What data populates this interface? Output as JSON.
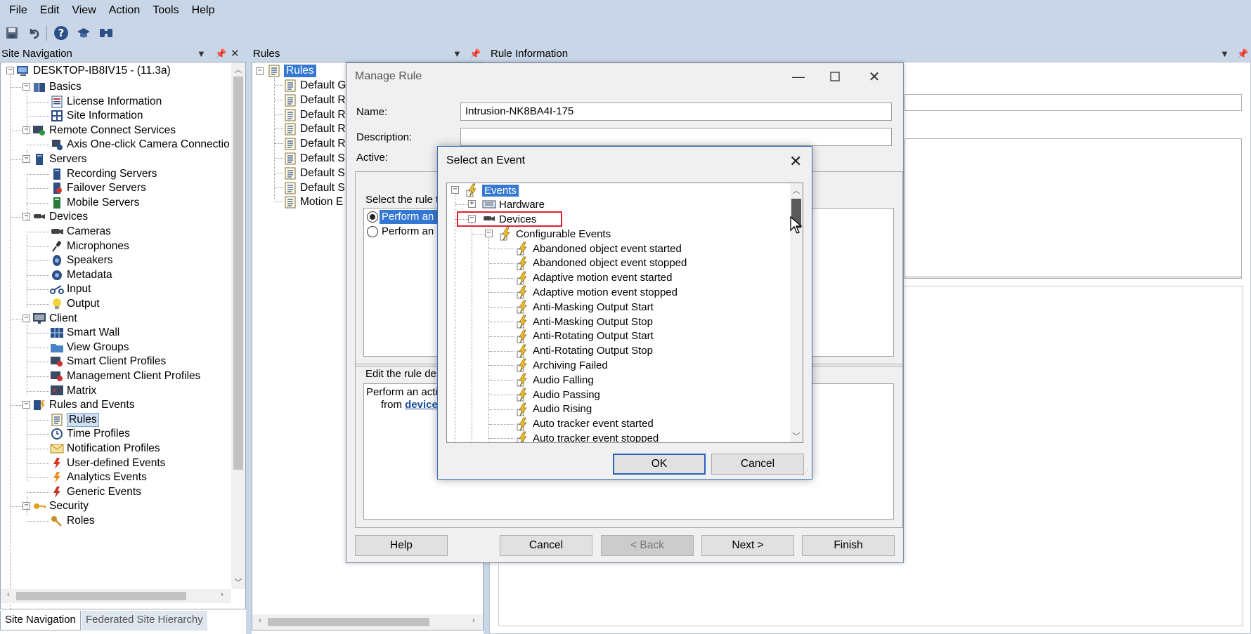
{
  "menu": [
    "File",
    "Edit",
    "View",
    "Action",
    "Tools",
    "Help"
  ],
  "panes": {
    "site_nav_title": "Site Navigation",
    "rules_title": "Rules",
    "rule_info_title": "Rule Information"
  },
  "site_tree": {
    "root": "DESKTOP-IB8IV15 - (11.3a)",
    "items": [
      {
        "label": "Basics",
        "level": 1,
        "expander": "minus"
      },
      {
        "label": "License Information",
        "level": 2
      },
      {
        "label": "Site Information",
        "level": 2
      },
      {
        "label": "Remote Connect Services",
        "level": 1,
        "expander": "minus"
      },
      {
        "label": "Axis One-click Camera Connectio",
        "level": 2
      },
      {
        "label": "Servers",
        "level": 1,
        "expander": "minus"
      },
      {
        "label": "Recording Servers",
        "level": 2
      },
      {
        "label": "Failover Servers",
        "level": 2
      },
      {
        "label": "Mobile Servers",
        "level": 2
      },
      {
        "label": "Devices",
        "level": 1,
        "expander": "minus"
      },
      {
        "label": "Cameras",
        "level": 2
      },
      {
        "label": "Microphones",
        "level": 2
      },
      {
        "label": "Speakers",
        "level": 2
      },
      {
        "label": "Metadata",
        "level": 2
      },
      {
        "label": "Input",
        "level": 2
      },
      {
        "label": "Output",
        "level": 2
      },
      {
        "label": "Client",
        "level": 1,
        "expander": "minus"
      },
      {
        "label": "Smart Wall",
        "level": 2
      },
      {
        "label": "View Groups",
        "level": 2
      },
      {
        "label": "Smart Client Profiles",
        "level": 2
      },
      {
        "label": "Management Client Profiles",
        "level": 2
      },
      {
        "label": "Matrix",
        "level": 2
      },
      {
        "label": "Rules and Events",
        "level": 1,
        "expander": "minus"
      },
      {
        "label": "Rules",
        "level": 2,
        "selected": true
      },
      {
        "label": "Time Profiles",
        "level": 2
      },
      {
        "label": "Notification Profiles",
        "level": 2
      },
      {
        "label": "User-defined Events",
        "level": 2
      },
      {
        "label": "Analytics Events",
        "level": 2
      },
      {
        "label": "Generic Events",
        "level": 2
      },
      {
        "label": "Security",
        "level": 1,
        "expander": "minus"
      },
      {
        "label": "Roles",
        "level": 2
      }
    ]
  },
  "bottom_tabs": [
    "Site Navigation",
    "Federated Site Hierarchy"
  ],
  "rules_tree": {
    "root": "Rules",
    "items": [
      "Default G",
      "Default R",
      "Default R",
      "Default R",
      "Default R",
      "Default S",
      "Default S",
      "Default S",
      "Motion E"
    ]
  },
  "manage_rule": {
    "title": "Manage Rule",
    "name_label": "Name:",
    "name_value": "Intrusion-NK8BA4I-175",
    "description_label": "Description:",
    "active_label": "Active:",
    "select_type_label": "Select the rule ty",
    "radio1": "Perform an a",
    "radio2": "Perform an a",
    "edit_desc_label": "Edit the rule des",
    "desc_line1": "Perform an actio",
    "desc_line2_prefix": "from ",
    "desc_line2_link": "device",
    "buttons": {
      "help": "Help",
      "cancel": "Cancel",
      "back": "< Back",
      "next": "Next >",
      "finish": "Finish"
    }
  },
  "select_event": {
    "title": "Select an Event",
    "root": "Events",
    "hardware": "Hardware",
    "devices": "Devices",
    "configurable": "Configurable Events",
    "events": [
      "Abandoned object event started",
      "Abandoned object event stopped",
      "Adaptive motion event started",
      "Adaptive motion event stopped",
      "Anti-Masking Output Start",
      "Anti-Masking Output Stop",
      "Anti-Rotating Output Start",
      "Anti-Rotating Output Stop",
      "Archiving Failed",
      "Audio Falling",
      "Audio Passing",
      "Audio Rising",
      "Auto tracker event started",
      "Auto tracker event stopped"
    ],
    "ok": "OK",
    "cancel": "Cancel"
  },
  "colors": {
    "chrome": "#c8d6e8",
    "highlight": "#3478d4",
    "red_outline": "#e0202c"
  }
}
